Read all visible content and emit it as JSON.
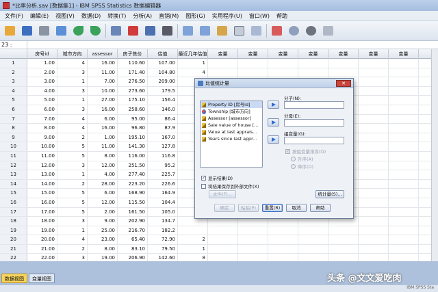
{
  "window": {
    "title": "*比率分析.sav [数据集1] - IBM SPSS Statistics 数据编辑器"
  },
  "menu": [
    "文件(F)",
    "编辑(E)",
    "视图(V)",
    "数据(D)",
    "转换(T)",
    "分析(A)",
    "直销(M)",
    "图形(G)",
    "实用程序(U)",
    "窗口(W)",
    "帮助"
  ],
  "toolbar_icons": [
    "open-icon",
    "save-icon",
    "print-icon",
    "dialog-recall-icon",
    "undo-icon",
    "redo-icon",
    "goto-case-icon",
    "goto-variable-icon",
    "variables-icon",
    "find-icon",
    "insert-cases-icon",
    "insert-variable-icon",
    "split-file-icon",
    "weight-cases-icon",
    "select-cases-icon",
    "value-labels-icon",
    "use-sets-icon",
    "show-all-icon",
    "spelling-icon"
  ],
  "cellbar": {
    "ref": "23 :"
  },
  "grid": {
    "columns": [
      "房号id",
      "城市方向",
      "assessor",
      "房子售价",
      "估值",
      "最近几年估值",
      "变量",
      "变量",
      "变量",
      "变量",
      "变量",
      "变量",
      "变量"
    ],
    "rows": [
      [
        "1",
        "1.00",
        "4",
        "16.00",
        "110.60",
        "107.00",
        "1"
      ],
      [
        "2",
        "2.00",
        "3",
        "11.00",
        "171.40",
        "104.80",
        "4"
      ],
      [
        "3",
        "3.00",
        "1",
        "7.00",
        "276.50",
        "209.00",
        ""
      ],
      [
        "4",
        "4.00",
        "3",
        "10.00",
        "273.60",
        "179.5",
        ""
      ],
      [
        "5",
        "5.00",
        "1",
        "27.00",
        "175.10",
        "156.4",
        ""
      ],
      [
        "6",
        "6.00",
        "3",
        "16.00",
        "258.60",
        "146.0",
        ""
      ],
      [
        "7",
        "7.00",
        "4",
        "6.00",
        "95.00",
        "86.4",
        ""
      ],
      [
        "8",
        "8.00",
        "4",
        "16.00",
        "96.80",
        "87.9",
        ""
      ],
      [
        "9",
        "9.00",
        "2",
        "1.00",
        "195.10",
        "167.0",
        ""
      ],
      [
        "10",
        "10.00",
        "5",
        "11.00",
        "141.30",
        "127.8",
        ""
      ],
      [
        "11",
        "11.00",
        "5",
        "8.00",
        "116.00",
        "116.8",
        ""
      ],
      [
        "12",
        "12.00",
        "3",
        "12.00",
        "251.50",
        "95.2",
        ""
      ],
      [
        "13",
        "13.00",
        "1",
        "4.00",
        "277.40",
        "225.7",
        ""
      ],
      [
        "14",
        "14.00",
        "2",
        "28.00",
        "223.20",
        "226.6",
        ""
      ],
      [
        "15",
        "15.00",
        "5",
        "6.00",
        "168.90",
        "164.9",
        ""
      ],
      [
        "16",
        "16.00",
        "5",
        "12.00",
        "115.50",
        "104.4",
        ""
      ],
      [
        "17",
        "17.00",
        "5",
        "2.00",
        "161.50",
        "105.0",
        ""
      ],
      [
        "18",
        "18.00",
        "3",
        "9.00",
        "202.90",
        "134.7",
        ""
      ],
      [
        "19",
        "19.00",
        "1",
        "25.00",
        "216.70",
        "182.2",
        ""
      ],
      [
        "20",
        "20.00",
        "4",
        "23.00",
        "65.40",
        "72.90",
        "2"
      ],
      [
        "21",
        "21.00",
        "2",
        "8.00",
        "83.10",
        "79.50",
        "1"
      ],
      [
        "22",
        "22.00",
        "3",
        "19.00",
        "206.90",
        "142.60",
        "8"
      ],
      [
        "23",
        "23.00",
        "4",
        "19.00",
        "121.60",
        "97.70",
        "1"
      ]
    ]
  },
  "tabs": {
    "data_view": "数据视图",
    "variable_view": "变量视图"
  },
  "status": {
    "processor": "IBM SPSS Sta"
  },
  "watermark": "头条 @文文爱吃肉",
  "dialog": {
    "title": "比值统计量",
    "variables": [
      {
        "label": "Property ID [房号id]",
        "type": "scale",
        "selected": true
      },
      {
        "label": "Township [城市方向]",
        "type": "nominal",
        "selected": false
      },
      {
        "label": "Assessor [assessor]",
        "type": "scale",
        "selected": false
      },
      {
        "label": "Sale value of house [...",
        "type": "scale",
        "selected": false
      },
      {
        "label": "Value at last apprais...",
        "type": "scale",
        "selected": false
      },
      {
        "label": "Years since last appr...",
        "type": "scale",
        "selected": false
      }
    ],
    "numerator_label": "分子(N):",
    "denominator_label": "分母(E):",
    "group_label": "组变量(G):",
    "sort_label": "按组变量排序(O)",
    "ascending_label": "升序(A)",
    "descending_label": "降序(D)",
    "display_results_label": "显示结果(D)",
    "save_results_label": "将结果保存到外部文件(X)",
    "file_button": "文件(F)...",
    "statistics_button": "统计量(S)...",
    "ok_button": "确定",
    "paste_button": "粘贴(P)",
    "reset_button": "重置(R)",
    "cancel_button": "取消",
    "help_button": "帮助"
  }
}
